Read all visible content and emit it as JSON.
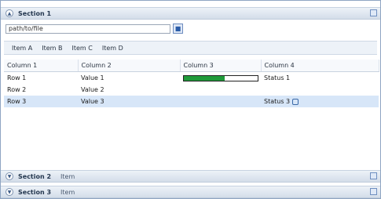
{
  "top_section": {
    "title": "Section 1",
    "subtitle": ""
  },
  "path": {
    "value": "path/to/file"
  },
  "summary": {
    "items": [
      "Item A",
      "Item B",
      "Item C",
      "Item D"
    ]
  },
  "table": {
    "columns": [
      "Column 1",
      "Column 2",
      "Column 3",
      "Column 4"
    ],
    "rows": [
      {
        "c1": "Row 1",
        "c2": "Value 1",
        "progress": 0.55,
        "c4": "Status 1"
      },
      {
        "c1": "Row 2",
        "c2": "Value 2",
        "progress": null,
        "c4": ""
      },
      {
        "c1": "Row 3",
        "c2": "Value 3",
        "progress": null,
        "c4": "Status 3",
        "selected": true
      }
    ]
  },
  "section2": {
    "title": "Section 2",
    "subtitle": "Item"
  },
  "section3": {
    "title": "Section 3",
    "subtitle": "Item"
  }
}
